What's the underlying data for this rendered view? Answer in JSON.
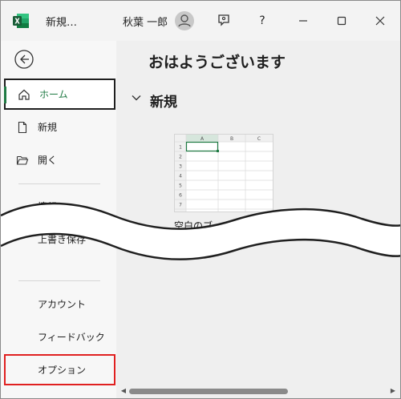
{
  "titlebar": {
    "doc_title": "新規…",
    "user_name": "秋葉 一郎",
    "icons": [
      "excel-logo",
      "avatar",
      "feedback-icon",
      "help-icon",
      "minimize-icon",
      "maximize-icon",
      "close-icon"
    ],
    "help_glyph": "?"
  },
  "nav": {
    "back_icon": "back-arrow-icon",
    "items": [
      {
        "label": "ホーム",
        "icon": "home-icon",
        "selected": true
      },
      {
        "label": "新規",
        "icon": "new-file-icon"
      },
      {
        "label": "開く",
        "icon": "open-folder-icon"
      },
      {
        "label": "情報"
      },
      {
        "label": "上書き保存"
      },
      {
        "label": "アカウント"
      },
      {
        "label": "フィードバック"
      },
      {
        "label": "オプション",
        "highlighted": true
      }
    ]
  },
  "main": {
    "greeting": "おはようございます",
    "section_title": "新規",
    "template": {
      "label": "空白のブック",
      "columns": [
        "A",
        "B",
        "C"
      ],
      "rows": [
        "1",
        "2",
        "3",
        "4",
        "5",
        "6",
        "7"
      ]
    }
  },
  "colors": {
    "accent_green": "#1f7a43",
    "highlight_red": "#e02020",
    "background": "#efefef"
  }
}
